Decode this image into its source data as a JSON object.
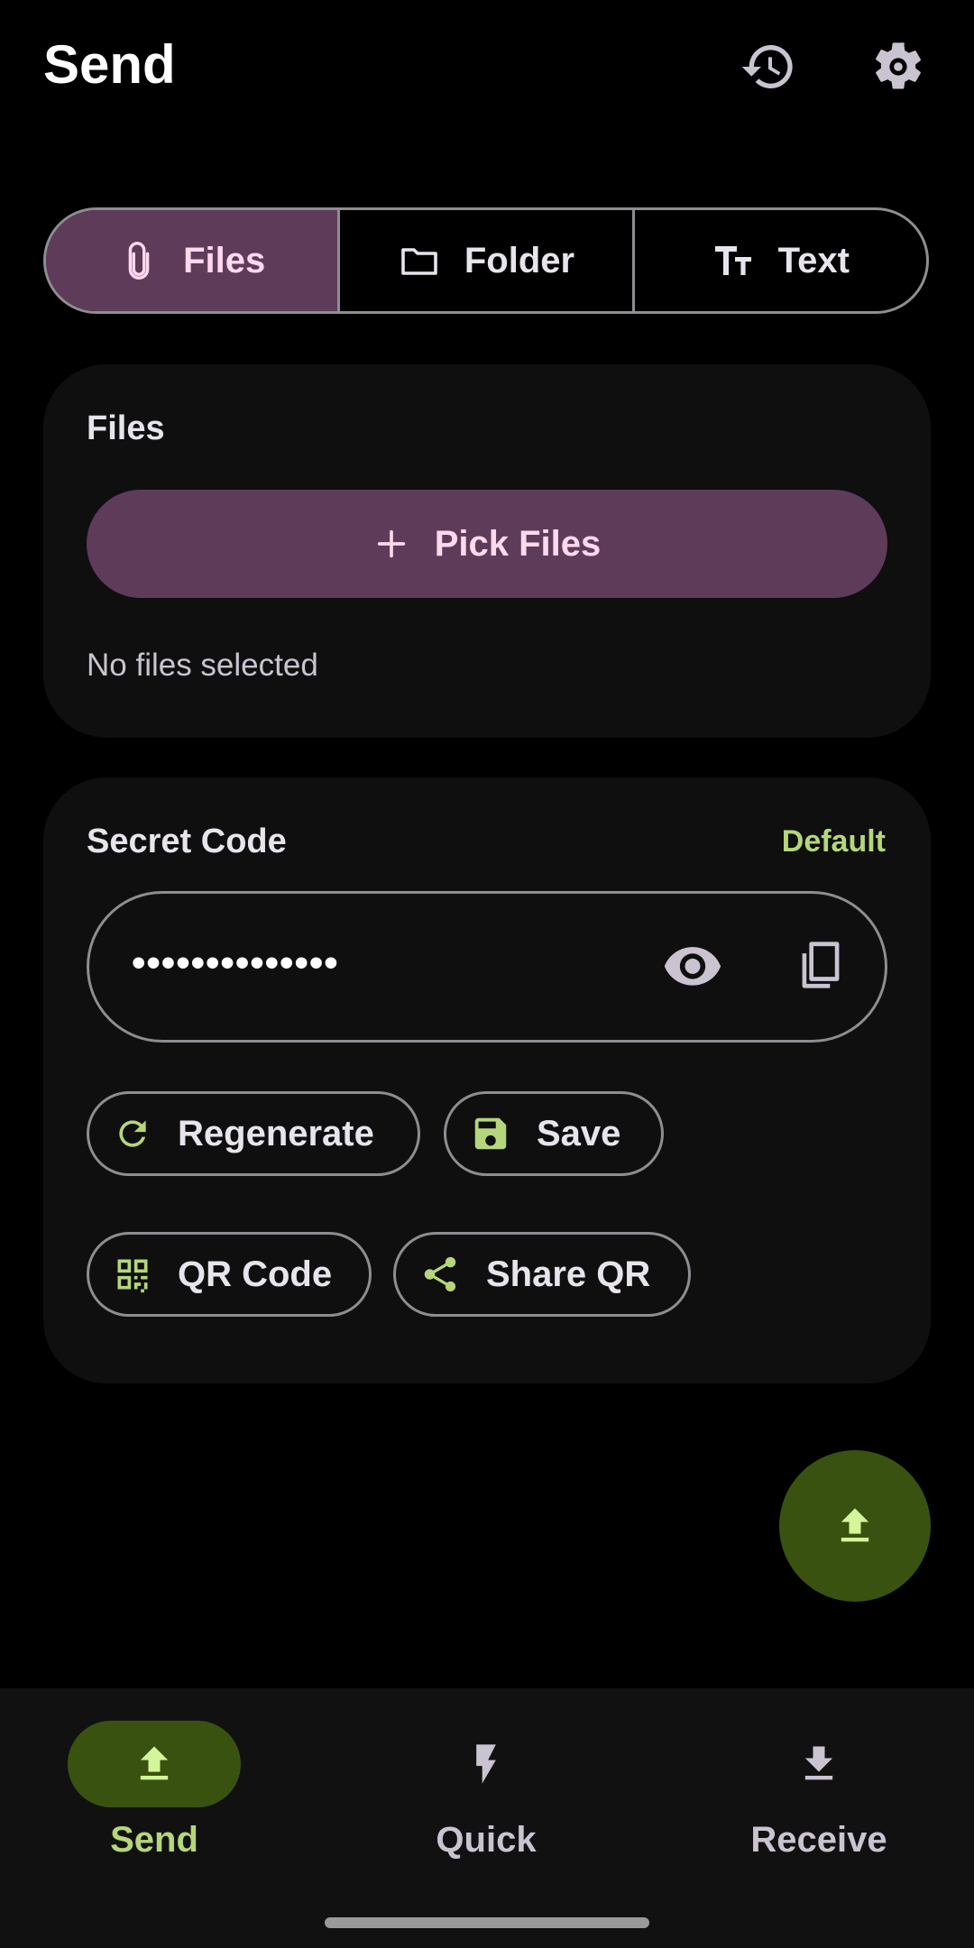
{
  "header": {
    "title": "Send",
    "history_icon": "history-icon",
    "settings_icon": "gear-icon"
  },
  "tabs": [
    {
      "label": "Files",
      "icon": "paperclip-icon",
      "selected": true
    },
    {
      "label": "Folder",
      "icon": "folder-icon",
      "selected": false
    },
    {
      "label": "Text",
      "icon": "text-size-icon",
      "selected": false
    }
  ],
  "files_card": {
    "title": "Files",
    "pick_button_label": "Pick Files",
    "empty_text": "No files selected"
  },
  "secret_card": {
    "title": "Secret Code",
    "mode_label": "Default",
    "masked_value": "••••••••••••••",
    "regenerate_label": "Regenerate",
    "save_label": "Save",
    "qr_label": "QR Code",
    "share_qr_label": "Share QR"
  },
  "fab": {
    "icon": "upload-icon"
  },
  "bottom_nav": [
    {
      "label": "Send",
      "icon": "upload-icon",
      "selected": true
    },
    {
      "label": "Quick",
      "icon": "bolt-icon",
      "selected": false
    },
    {
      "label": "Receive",
      "icon": "download-icon",
      "selected": false
    }
  ],
  "colors": {
    "background": "#000000",
    "card": "#0f0f0f",
    "primary_container": "#5e3c59",
    "on_primary_container": "#ffd8ee",
    "accent_green": "#b5d67a",
    "fab": "#3a5210",
    "outline": "#8e8d92"
  }
}
